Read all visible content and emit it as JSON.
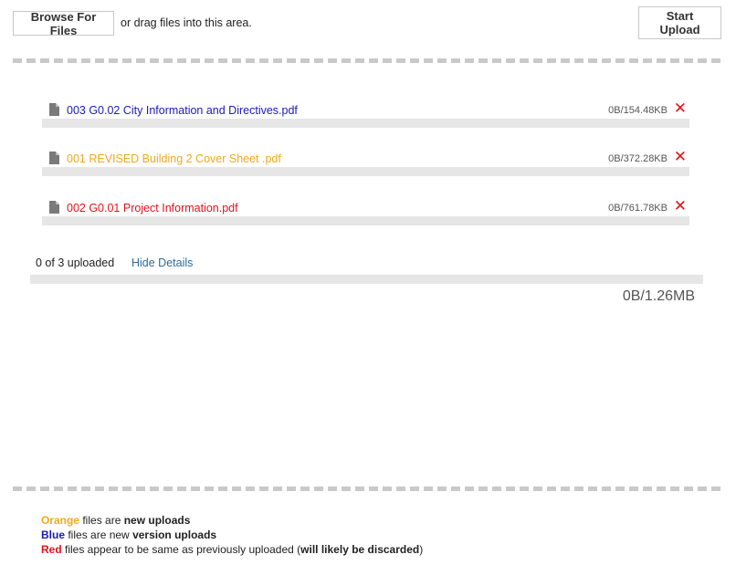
{
  "toolbar": {
    "browse_label": "Browse For Files",
    "drag_hint": "or drag files into this area.",
    "start_label": "Start Upload"
  },
  "colors": {
    "orange": "#f0a81e",
    "blue": "#1a1ab8",
    "red": "#e3121b",
    "link": "#2e6b9a"
  },
  "files": [
    {
      "name": "003 G0.02 City Information and Directives.pdf",
      "size": "0B/154.48KB",
      "status": "blue",
      "progress_percent": 0,
      "icon": "file-icon",
      "remove_icon": "remove-icon"
    },
    {
      "name": "001 REVISED Building 2 Cover Sheet .pdf",
      "size": "0B/372.28KB",
      "status": "orange",
      "progress_percent": 0,
      "icon": "file-icon",
      "remove_icon": "remove-icon"
    },
    {
      "name": "002 G0.01 Project Information.pdf",
      "size": "0B/761.78KB",
      "status": "red",
      "progress_percent": 0,
      "icon": "file-icon",
      "remove_icon": "remove-icon"
    }
  ],
  "summary": {
    "uploaded_text": "0 of 3 uploaded",
    "hide_details": "Hide Details",
    "total_size": "0B/1.26MB",
    "progress_percent": 0
  },
  "remove_glyph": "✕",
  "legend": [
    {
      "color_word": "Orange",
      "color": "orange",
      "text_before": " files are ",
      "bold": "new uploads",
      "text_after": ""
    },
    {
      "color_word": "Blue",
      "color": "blue",
      "text_before": " files are new ",
      "bold": "version uploads",
      "text_after": ""
    },
    {
      "color_word": "Red",
      "color": "red",
      "text_before": " files appear to be same as previously uploaded (",
      "bold": "will likely be discarded",
      "text_after": ")"
    }
  ]
}
